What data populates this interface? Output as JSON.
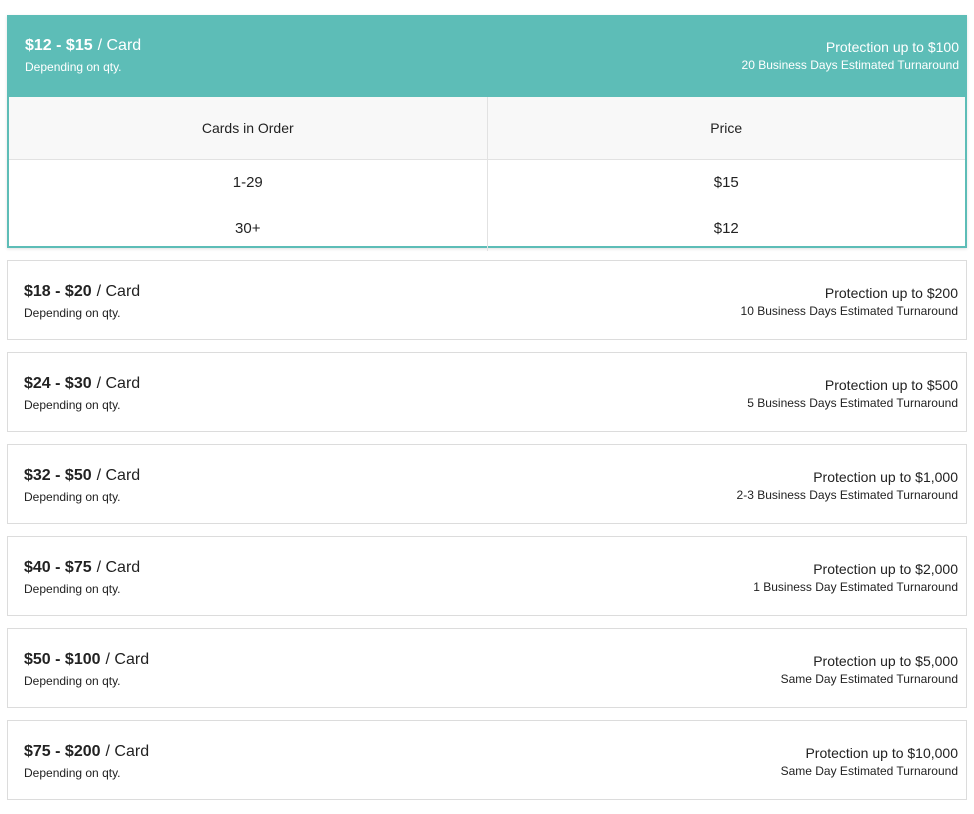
{
  "open_tier": {
    "range": "$12 - $15",
    "unit": "/ Card",
    "qty_note": "Depending on qty.",
    "protection": "Protection up to $100",
    "turnaround": "20 Business Days Estimated Turnaround",
    "table": {
      "headers": [
        "Cards in Order",
        "Price"
      ],
      "rows": [
        [
          "1-29",
          "$15"
        ],
        [
          "30+",
          "$12"
        ]
      ]
    },
    "accent_color": "#5dbdb7"
  },
  "tiers": [
    {
      "range": "$18 - $20",
      "unit": "/ Card",
      "qty_note": "Depending on qty.",
      "protection": "Protection up to $200",
      "turnaround": "10 Business Days Estimated Turnaround"
    },
    {
      "range": "$24 - $30",
      "unit": "/ Card",
      "qty_note": "Depending on qty.",
      "protection": "Protection up to $500",
      "turnaround": "5 Business Days Estimated Turnaround"
    },
    {
      "range": "$32 - $50",
      "unit": "/ Card",
      "qty_note": "Depending on qty.",
      "protection": "Protection up to $1,000",
      "turnaround": "2-3 Business Days Estimated Turnaround"
    },
    {
      "range": "$40 - $75",
      "unit": "/ Card",
      "qty_note": "Depending on qty.",
      "protection": "Protection up to $2,000",
      "turnaround": "1 Business Day Estimated Turnaround"
    },
    {
      "range": "$50 - $100",
      "unit": "/ Card",
      "qty_note": "Depending on qty.",
      "protection": "Protection up to $5,000",
      "turnaround": "Same Day Estimated Turnaround"
    },
    {
      "range": "$75 - $200",
      "unit": "/ Card",
      "qty_note": "Depending on qty.",
      "protection": "Protection up to $10,000",
      "turnaround": "Same Day Estimated Turnaround"
    }
  ]
}
